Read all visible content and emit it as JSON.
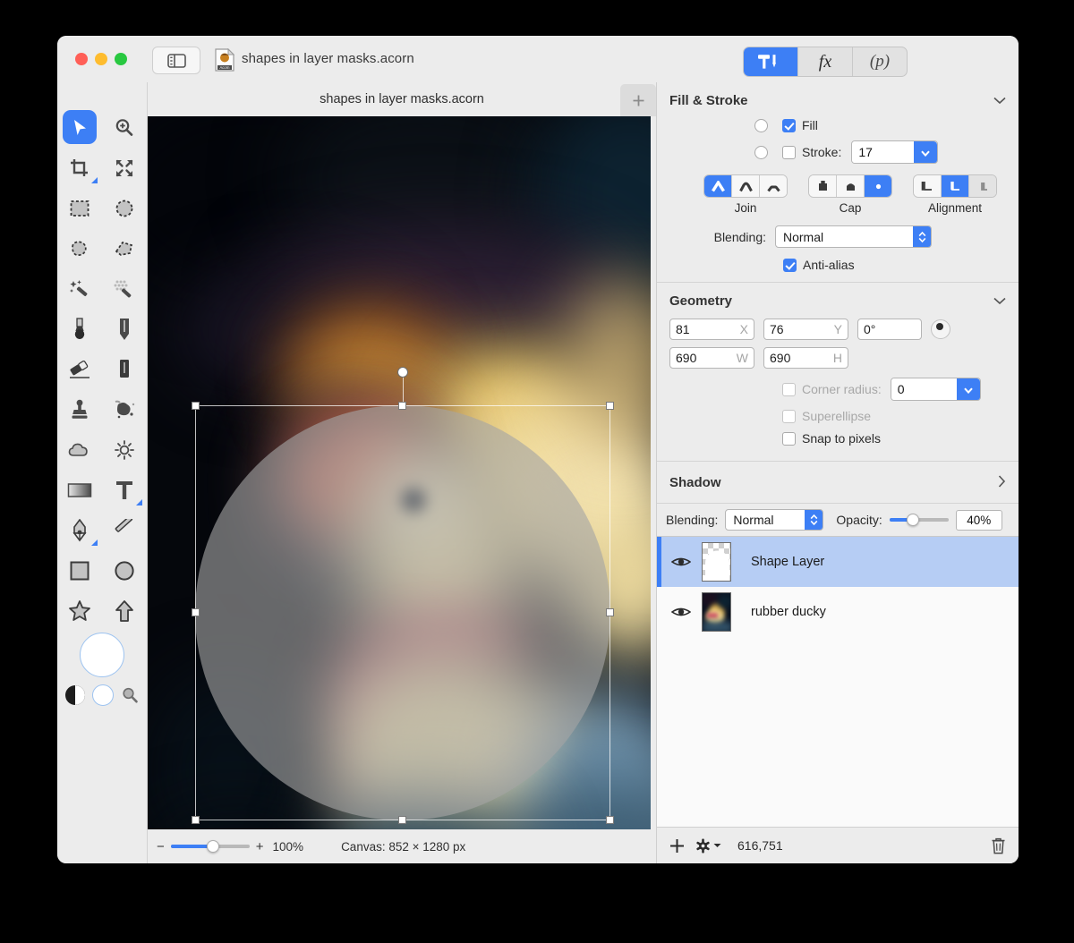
{
  "window": {
    "titlebar": {
      "traffic_lights": [
        "close",
        "minimize",
        "zoom"
      ],
      "sidebar_toggle_icon": "sidebar-toggle-icon",
      "doc_icon": "acorn-document-icon",
      "doc_title": "shapes in layer masks.acorn",
      "segments": [
        {
          "name": "tools-inspector",
          "icon": "hammer-and-pen-icon",
          "selected": true
        },
        {
          "name": "filters-inspector",
          "icon": "fx-icon",
          "label": "fx",
          "selected": false
        },
        {
          "name": "presets-inspector",
          "icon": "p-in-parens-icon",
          "label": "(p)",
          "selected": false
        }
      ]
    }
  },
  "tools": {
    "items": [
      {
        "name": "move-tool",
        "icon": "arrow-cursor-icon",
        "selected": true
      },
      {
        "name": "zoom-tool",
        "icon": "magnifier-plus-icon",
        "selected": false
      },
      {
        "name": "crop-tool",
        "icon": "crop-icon",
        "selected": false,
        "has_submenu": true
      },
      {
        "name": "transform-tool",
        "icon": "four-arrows-icon",
        "selected": false
      },
      {
        "name": "rect-select-tool",
        "icon": "dashed-rectangle-icon",
        "selected": false
      },
      {
        "name": "ellipse-select-tool",
        "icon": "dashed-circle-icon",
        "selected": false
      },
      {
        "name": "lasso-tool",
        "icon": "lasso-icon",
        "selected": false
      },
      {
        "name": "polygon-lasso-tool",
        "icon": "polygon-lasso-icon",
        "selected": false
      },
      {
        "name": "magic-wand-tool",
        "icon": "magic-wand-icon",
        "selected": false
      },
      {
        "name": "instant-alpha-tool",
        "icon": "halftone-wand-icon",
        "selected": false
      },
      {
        "name": "brush-tool",
        "icon": "brush-icon",
        "selected": false
      },
      {
        "name": "pencil-tool",
        "icon": "pencil-icon",
        "selected": false
      },
      {
        "name": "eraser-tool",
        "icon": "eraser-icon",
        "selected": false
      },
      {
        "name": "smudge-tool",
        "icon": "smudge-icon",
        "selected": false
      },
      {
        "name": "clone-stamp-tool",
        "icon": "clone-stamp-icon",
        "selected": false
      },
      {
        "name": "dodge-burn-tool",
        "icon": "splatter-icon",
        "selected": false
      },
      {
        "name": "blur-tool",
        "icon": "cloud-icon",
        "selected": false
      },
      {
        "name": "sharpen-tool",
        "icon": "sun-icon",
        "selected": false
      },
      {
        "name": "gradient-tool",
        "icon": "gradient-icon",
        "selected": false
      },
      {
        "name": "text-tool",
        "icon": "text-t-icon",
        "selected": false,
        "has_submenu": true
      },
      {
        "name": "bezier-pen-tool",
        "icon": "fountain-pen-icon",
        "selected": false,
        "has_submenu": true
      },
      {
        "name": "line-tool",
        "icon": "line-icon",
        "selected": false
      },
      {
        "name": "rectangle-shape-tool",
        "icon": "square-icon",
        "selected": false
      },
      {
        "name": "ellipse-shape-tool",
        "icon": "circle-icon",
        "selected": false
      },
      {
        "name": "star-shape-tool",
        "icon": "star-icon",
        "selected": false
      },
      {
        "name": "arrow-shape-tool",
        "icon": "arrow-up-icon",
        "selected": false
      }
    ],
    "swatches": {
      "foreground": "#ffffff",
      "background": "#ffffff",
      "swap_icon": "yin-yang-icon",
      "reset_icon": "small-circle-icon",
      "palette_icon": "magnifier-icon"
    }
  },
  "canvas": {
    "tab_title": "shapes in layer masks.acorn",
    "add_tab_label": "+",
    "statusbar": {
      "zoom_out_label": "−",
      "zoom_in_label": "+",
      "zoom_percent": "100%",
      "canvas_size": "Canvas: 852 × 1280 px",
      "slider_value": 50
    },
    "selection": {
      "handles": 8,
      "rotation_handle": true
    }
  },
  "inspector": {
    "fill_stroke": {
      "title": "Fill & Stroke",
      "collapse_icon": "chevron-down-icon",
      "fill": {
        "label": "Fill",
        "checked": true,
        "radio_selected": false
      },
      "stroke": {
        "label": "Stroke:",
        "checked": false,
        "radio_selected": false,
        "width": "17"
      },
      "join": {
        "label": "Join",
        "options": [
          "miter-join",
          "round-join",
          "bevel-join"
        ],
        "selected": 0
      },
      "cap": {
        "label": "Cap",
        "options": [
          "butt-cap",
          "square-cap",
          "round-cap"
        ],
        "selected": 2
      },
      "alignment": {
        "label": "Alignment",
        "options": [
          "align-inside",
          "align-center",
          "align-outside"
        ],
        "selected": 1
      },
      "blending": {
        "label": "Blending:",
        "value": "Normal"
      },
      "antialias": {
        "label": "Anti-alias",
        "checked": true
      }
    },
    "geometry": {
      "title": "Geometry",
      "collapse_icon": "chevron-down-icon",
      "x": {
        "value": "81",
        "suffix": "X"
      },
      "y": {
        "value": "76",
        "suffix": "Y"
      },
      "rotation": {
        "value": "0°"
      },
      "anchor_icon": "anchor-point-icon",
      "w": {
        "value": "690",
        "suffix": "W"
      },
      "h": {
        "value": "690",
        "suffix": "H"
      },
      "corner_radius": {
        "label": "Corner radius:",
        "checked": false,
        "disabled": true,
        "value": "0"
      },
      "superellipse": {
        "label": "Superellipse",
        "checked": false,
        "disabled": true
      },
      "snap_to_pixels": {
        "label": "Snap to pixels",
        "checked": false,
        "disabled": false
      }
    },
    "shadow": {
      "title": "Shadow",
      "expand_icon": "chevron-right-icon"
    }
  },
  "layers": {
    "toolbar": {
      "blending_label": "Blending:",
      "blending_value": "Normal",
      "opacity_label": "Opacity:",
      "opacity_value": "40%",
      "opacity_slider": 40
    },
    "items": [
      {
        "name": "Shape Layer",
        "visible": true,
        "selected": true,
        "thumb": "transparent-shape"
      },
      {
        "name": "rubber ducky",
        "visible": true,
        "selected": false,
        "thumb": "photo"
      }
    ],
    "footer": {
      "add_icon": "plus-icon",
      "settings_icon": "gear-icon",
      "settings_arrow_icon": "chevron-down-icon",
      "count": "616,751",
      "delete_icon": "trash-icon"
    }
  },
  "colors": {
    "accent": "#3d7ff5",
    "window_chrome": "#ececec",
    "selection_blue": "#b6cdf4"
  }
}
